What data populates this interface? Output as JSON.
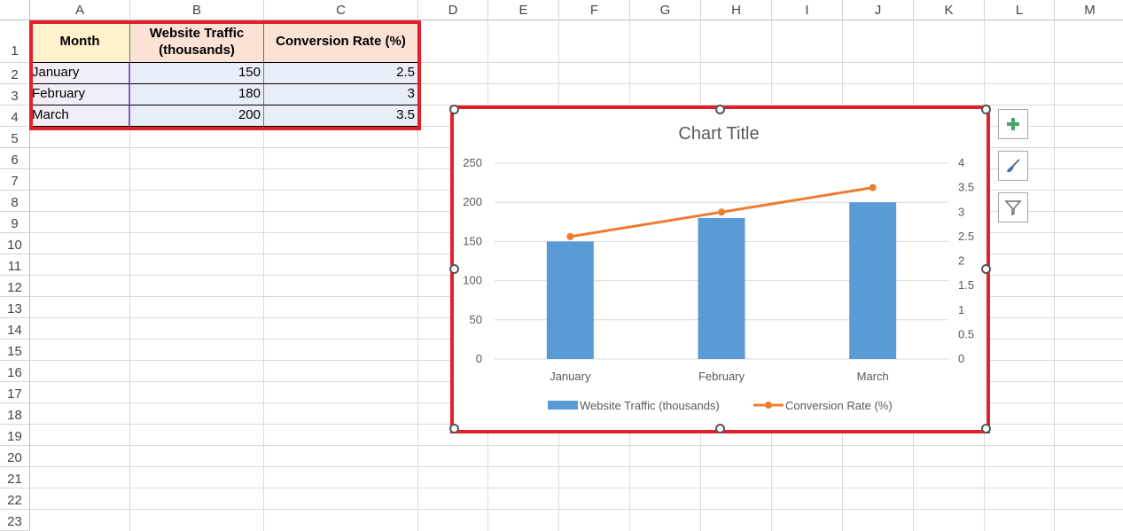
{
  "sheet": {
    "columns": [
      "A",
      "B",
      "C",
      "D",
      "E",
      "F",
      "G",
      "H",
      "I",
      "J",
      "K",
      "L",
      "M"
    ],
    "rows": [
      "1",
      "2",
      "3",
      "4",
      "5",
      "6",
      "7",
      "8",
      "9",
      "10",
      "11",
      "12",
      "13",
      "14",
      "15",
      "16",
      "17",
      "18",
      "19",
      "20",
      "21",
      "22",
      "23"
    ]
  },
  "table": {
    "headers": [
      "Month",
      "Website Traffic (thousands)",
      "Conversion Rate (%)"
    ],
    "rows": [
      [
        "January",
        "150",
        "2.5"
      ],
      [
        "February",
        "180",
        "3"
      ],
      [
        "March",
        "200",
        "3.5"
      ]
    ],
    "header_fill_a": "#fff2cc",
    "header_fill_bc": "#fbe2d5",
    "data_fill_a": "#f2eef8",
    "data_fill_bc": "#e8eef8"
  },
  "chart_data": {
    "type": "bar",
    "title": "Chart Title",
    "categories": [
      "January",
      "February",
      "March"
    ],
    "series": [
      {
        "name": "Website Traffic (thousands)",
        "type": "bar",
        "axis": "left",
        "values": [
          150,
          180,
          200
        ],
        "color": "#5b9bd5"
      },
      {
        "name": "Conversion Rate (%)",
        "type": "line",
        "axis": "right",
        "values": [
          2.5,
          3,
          3.5
        ],
        "color": "#ed7d31"
      }
    ],
    "y_left": {
      "min": 0,
      "max": 250,
      "ticks": [
        "0",
        "50",
        "100",
        "150",
        "200",
        "250"
      ]
    },
    "y_right": {
      "min": 0,
      "max": 4,
      "ticks": [
        "0",
        "0.5",
        "1",
        "1.5",
        "2",
        "2.5",
        "3",
        "3.5",
        "4"
      ]
    },
    "grid": true,
    "legend": "bottom"
  },
  "colors": {
    "selection": "#e0202a",
    "plus_icon": "#4ca36c",
    "icon_gray": "#6d6d6d",
    "brush_icon": "#3f72b5"
  },
  "icons": {
    "add_chart_element": "plus-icon",
    "chart_styles": "brush-icon",
    "chart_filters": "funnel-icon"
  }
}
